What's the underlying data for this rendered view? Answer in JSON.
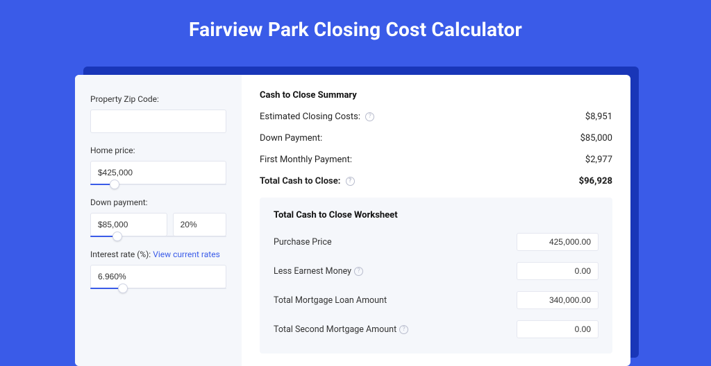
{
  "title": "Fairview Park Closing Cost Calculator",
  "form": {
    "zip": {
      "label": "Property Zip Code:",
      "value": ""
    },
    "price": {
      "label": "Home price:",
      "value": "$425,000",
      "slider_pct": 18
    },
    "down": {
      "label": "Down payment:",
      "amount": "$85,000",
      "percent": "20%",
      "slider_pct": 20
    },
    "rate": {
      "label": "Interest rate (%):",
      "link": "View current rates",
      "value": "6.960%",
      "slider_pct": 24
    }
  },
  "summary": {
    "title": "Cash to Close Summary",
    "rows": [
      {
        "label": "Estimated Closing Costs:",
        "help": true,
        "value": "$8,951"
      },
      {
        "label": "Down Payment:",
        "help": false,
        "value": "$85,000"
      },
      {
        "label": "First Monthly Payment:",
        "help": false,
        "value": "$2,977"
      }
    ],
    "total": {
      "label": "Total Cash to Close:",
      "help": true,
      "value": "$96,928"
    }
  },
  "worksheet": {
    "title": "Total Cash to Close Worksheet",
    "rows": [
      {
        "label": "Purchase Price",
        "help": false,
        "value": "425,000.00"
      },
      {
        "label": "Less Earnest Money",
        "help": true,
        "value": "0.00"
      },
      {
        "label": "Total Mortgage Loan Amount",
        "help": false,
        "value": "340,000.00"
      },
      {
        "label": "Total Second Mortgage Amount",
        "help": true,
        "value": "0.00"
      }
    ]
  }
}
